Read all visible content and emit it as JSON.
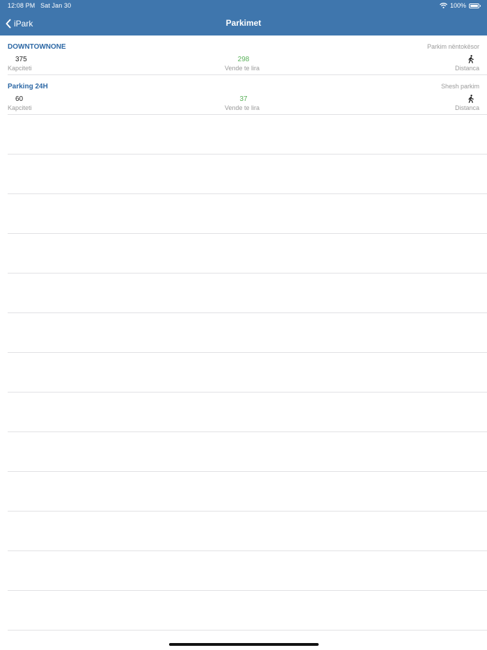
{
  "status_bar": {
    "time": "12:08 PM",
    "date": "Sat Jan 30",
    "battery": "100%"
  },
  "nav": {
    "back_label": "iPark",
    "title": "Parkimet"
  },
  "parkings": [
    {
      "name": "DOWNTOWNONE",
      "type": "Parkim nëntokësor",
      "capacity": "375",
      "capacity_label": "Kapciteti",
      "free": "298",
      "free_label": "Vende te lira",
      "distance_label": "Distanca"
    },
    {
      "name": "Parking 24H",
      "type": "Shesh parkim",
      "capacity": "60",
      "capacity_label": "Kapciteti",
      "free": "37",
      "free_label": "Vende te lira",
      "distance_label": "Distanca"
    }
  ],
  "colors": {
    "header": "#3f76ad",
    "name_text": "#2d68a5",
    "free_text": "#58b058",
    "muted_text": "#9a9a9a",
    "separator": "#e1e1e4"
  }
}
